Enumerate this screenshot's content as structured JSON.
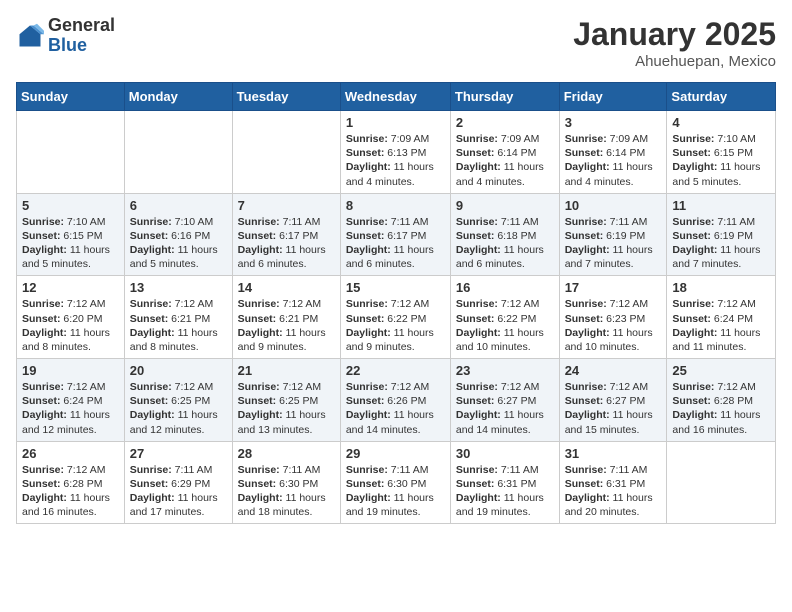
{
  "header": {
    "logo_general": "General",
    "logo_blue": "Blue",
    "month_year": "January 2025",
    "location": "Ahuehuepan, Mexico"
  },
  "days_of_week": [
    "Sunday",
    "Monday",
    "Tuesday",
    "Wednesday",
    "Thursday",
    "Friday",
    "Saturday"
  ],
  "weeks": [
    [
      {
        "day": "",
        "info": ""
      },
      {
        "day": "",
        "info": ""
      },
      {
        "day": "",
        "info": ""
      },
      {
        "day": "1",
        "info": "Sunrise: 7:09 AM\nSunset: 6:13 PM\nDaylight: 11 hours and 4 minutes."
      },
      {
        "day": "2",
        "info": "Sunrise: 7:09 AM\nSunset: 6:14 PM\nDaylight: 11 hours and 4 minutes."
      },
      {
        "day": "3",
        "info": "Sunrise: 7:09 AM\nSunset: 6:14 PM\nDaylight: 11 hours and 4 minutes."
      },
      {
        "day": "4",
        "info": "Sunrise: 7:10 AM\nSunset: 6:15 PM\nDaylight: 11 hours and 5 minutes."
      }
    ],
    [
      {
        "day": "5",
        "info": "Sunrise: 7:10 AM\nSunset: 6:15 PM\nDaylight: 11 hours and 5 minutes."
      },
      {
        "day": "6",
        "info": "Sunrise: 7:10 AM\nSunset: 6:16 PM\nDaylight: 11 hours and 5 minutes."
      },
      {
        "day": "7",
        "info": "Sunrise: 7:11 AM\nSunset: 6:17 PM\nDaylight: 11 hours and 6 minutes."
      },
      {
        "day": "8",
        "info": "Sunrise: 7:11 AM\nSunset: 6:17 PM\nDaylight: 11 hours and 6 minutes."
      },
      {
        "day": "9",
        "info": "Sunrise: 7:11 AM\nSunset: 6:18 PM\nDaylight: 11 hours and 6 minutes."
      },
      {
        "day": "10",
        "info": "Sunrise: 7:11 AM\nSunset: 6:19 PM\nDaylight: 11 hours and 7 minutes."
      },
      {
        "day": "11",
        "info": "Sunrise: 7:11 AM\nSunset: 6:19 PM\nDaylight: 11 hours and 7 minutes."
      }
    ],
    [
      {
        "day": "12",
        "info": "Sunrise: 7:12 AM\nSunset: 6:20 PM\nDaylight: 11 hours and 8 minutes."
      },
      {
        "day": "13",
        "info": "Sunrise: 7:12 AM\nSunset: 6:21 PM\nDaylight: 11 hours and 8 minutes."
      },
      {
        "day": "14",
        "info": "Sunrise: 7:12 AM\nSunset: 6:21 PM\nDaylight: 11 hours and 9 minutes."
      },
      {
        "day": "15",
        "info": "Sunrise: 7:12 AM\nSunset: 6:22 PM\nDaylight: 11 hours and 9 minutes."
      },
      {
        "day": "16",
        "info": "Sunrise: 7:12 AM\nSunset: 6:22 PM\nDaylight: 11 hours and 10 minutes."
      },
      {
        "day": "17",
        "info": "Sunrise: 7:12 AM\nSunset: 6:23 PM\nDaylight: 11 hours and 10 minutes."
      },
      {
        "day": "18",
        "info": "Sunrise: 7:12 AM\nSunset: 6:24 PM\nDaylight: 11 hours and 11 minutes."
      }
    ],
    [
      {
        "day": "19",
        "info": "Sunrise: 7:12 AM\nSunset: 6:24 PM\nDaylight: 11 hours and 12 minutes."
      },
      {
        "day": "20",
        "info": "Sunrise: 7:12 AM\nSunset: 6:25 PM\nDaylight: 11 hours and 12 minutes."
      },
      {
        "day": "21",
        "info": "Sunrise: 7:12 AM\nSunset: 6:25 PM\nDaylight: 11 hours and 13 minutes."
      },
      {
        "day": "22",
        "info": "Sunrise: 7:12 AM\nSunset: 6:26 PM\nDaylight: 11 hours and 14 minutes."
      },
      {
        "day": "23",
        "info": "Sunrise: 7:12 AM\nSunset: 6:27 PM\nDaylight: 11 hours and 14 minutes."
      },
      {
        "day": "24",
        "info": "Sunrise: 7:12 AM\nSunset: 6:27 PM\nDaylight: 11 hours and 15 minutes."
      },
      {
        "day": "25",
        "info": "Sunrise: 7:12 AM\nSunset: 6:28 PM\nDaylight: 11 hours and 16 minutes."
      }
    ],
    [
      {
        "day": "26",
        "info": "Sunrise: 7:12 AM\nSunset: 6:28 PM\nDaylight: 11 hours and 16 minutes."
      },
      {
        "day": "27",
        "info": "Sunrise: 7:11 AM\nSunset: 6:29 PM\nDaylight: 11 hours and 17 minutes."
      },
      {
        "day": "28",
        "info": "Sunrise: 7:11 AM\nSunset: 6:30 PM\nDaylight: 11 hours and 18 minutes."
      },
      {
        "day": "29",
        "info": "Sunrise: 7:11 AM\nSunset: 6:30 PM\nDaylight: 11 hours and 19 minutes."
      },
      {
        "day": "30",
        "info": "Sunrise: 7:11 AM\nSunset: 6:31 PM\nDaylight: 11 hours and 19 minutes."
      },
      {
        "day": "31",
        "info": "Sunrise: 7:11 AM\nSunset: 6:31 PM\nDaylight: 11 hours and 20 minutes."
      },
      {
        "day": "",
        "info": ""
      }
    ]
  ]
}
